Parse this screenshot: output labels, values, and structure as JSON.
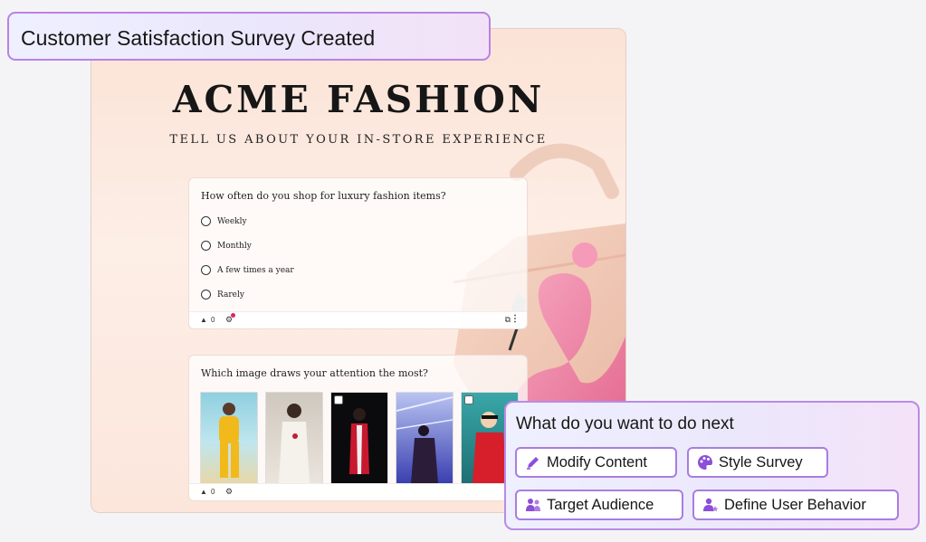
{
  "header": {
    "title": "Customer Satisfaction Survey Created"
  },
  "survey": {
    "brand": "ACME FASHION",
    "subtitle": "TELL US ABOUT YOUR IN-STORE EXPERIENCE",
    "question1": {
      "text": "How often do you shop for luxury fashion items?",
      "options": [
        "Weekly",
        "Monthly",
        "A few times a year",
        "Rarely"
      ],
      "reaction_count": "0"
    },
    "question2": {
      "text": "Which image draws your attention the most?",
      "reaction_count": "0"
    }
  },
  "next_panel": {
    "title": "What do you want to do next",
    "actions": [
      {
        "label": "Modify Content",
        "icon": "pencil-icon"
      },
      {
        "label": "Style Survey",
        "icon": "palette-icon"
      },
      {
        "label": "Target Audience",
        "icon": "people-icon"
      },
      {
        "label": "Define User Behavior",
        "icon": "user-star-icon"
      }
    ]
  },
  "colors": {
    "accent": "#a97de0",
    "header_border": "#b982e6",
    "card_background": "#fbe3d6"
  }
}
